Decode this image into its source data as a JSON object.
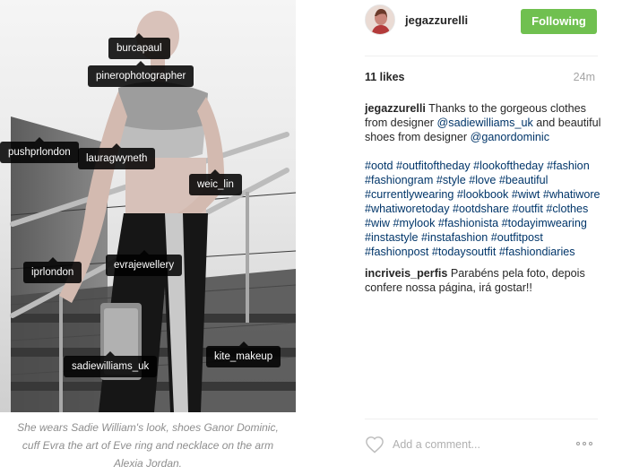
{
  "post": {
    "username": "jegazzurelli",
    "follow_label": "Following",
    "likes": "11 likes",
    "time": "24m",
    "caption_user": "jegazzurelli",
    "caption_text_1": " Thanks to the gorgeous clothes from designer ",
    "caption_mention_1": "@sadiewilliams_uk",
    "caption_text_2": " and beautiful shoes from designer ",
    "caption_mention_2": "@ganordominic",
    "hashtags": [
      "#ootd",
      "#outfitoftheday",
      "#lookoftheday",
      "#fashion",
      "#fashiongram",
      "#style",
      "#love",
      "#beautiful",
      "#currentlywearing",
      "#lookbook",
      "#wiwt",
      "#whatiwore",
      "#whatiworetoday",
      "#ootdshare",
      "#outfit",
      "#clothes",
      "#wiw",
      "#mylook",
      "#fashionista",
      "#todayimwearing",
      "#instastyle",
      "#instafashion",
      "#outfitpost",
      "#fashionpost",
      "#todaysoutfit",
      "#fashiondiaries"
    ],
    "comment_user": "incriveis_perfis",
    "comment_text": " Parabéns pela foto, depois confere nossa página, irá gostar!!",
    "add_comment_placeholder": "Add a comment...",
    "heart_icon": "heart-outline-icon",
    "more_icon": "more-options-icon"
  },
  "photo": {
    "tags": [
      "burcapaul",
      "pinerophotographer",
      "pushprlondon",
      "lauragwyneth",
      "weic_lin",
      "iprlondon",
      "evrajewellery",
      "kite_makeup",
      "sadiewilliams_uk"
    ],
    "caption": "She wears Sadie William's look, shoes Ganor Dominic, cuff Evra the art of Eve ring and necklace on the arm Alexia Jordan."
  },
  "colors": {
    "follow_green": "#70c050",
    "link_blue": "#003569",
    "muted": "#8e8e8e"
  }
}
